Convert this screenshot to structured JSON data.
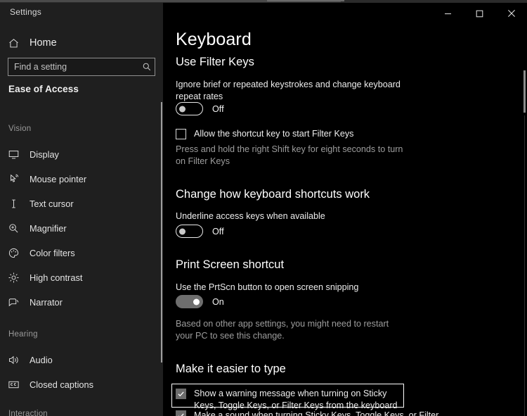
{
  "window": {
    "app_title": "Settings",
    "controls": [
      {
        "name": "minimize",
        "glyph": "–"
      },
      {
        "name": "maximize",
        "glyph": "□"
      },
      {
        "name": "close",
        "glyph": "✕"
      }
    ]
  },
  "sidebar": {
    "home_label": "Home",
    "home_icon": "home-icon",
    "search": {
      "placeholder": "Find a setting",
      "value": "",
      "icon": "search-icon"
    },
    "category_title": "Ease of Access",
    "groups": [
      {
        "heading": "Vision",
        "items": [
          {
            "label": "Display",
            "icon": "monitor-icon"
          },
          {
            "label": "Mouse pointer",
            "icon": "mouse-pointer-icon"
          },
          {
            "label": "Text cursor",
            "icon": "text-cursor-icon"
          },
          {
            "label": "Magnifier",
            "icon": "magnifier-icon"
          },
          {
            "label": "Color filters",
            "icon": "color-palette-icon"
          },
          {
            "label": "High contrast",
            "icon": "sun-contrast-icon"
          },
          {
            "label": "Narrator",
            "icon": "narrator-icon"
          }
        ]
      },
      {
        "heading": "Hearing",
        "items": [
          {
            "label": "Audio",
            "icon": "speaker-icon"
          },
          {
            "label": "Closed captions",
            "icon": "closed-captions-icon"
          }
        ]
      },
      {
        "heading": "Interaction",
        "items": []
      }
    ]
  },
  "main": {
    "page_title": "Keyboard",
    "sections": {
      "filter_keys": {
        "heading": "Use Filter Keys",
        "description": "Ignore brief or repeated keystrokes and change keyboard repeat rates",
        "toggle_state": "Off",
        "checkbox_label": "Allow the shortcut key to start Filter Keys",
        "checkbox_checked": false,
        "hint": "Press and hold the right Shift key for eight seconds to turn on Filter Keys"
      },
      "shortcuts": {
        "heading": "Change how keyboard shortcuts work",
        "description": "Underline access keys when available",
        "toggle_state": "Off"
      },
      "print_screen": {
        "heading": "Print Screen shortcut",
        "description": "Use the PrtScn button to open screen snipping",
        "toggle_state": "On",
        "hint": "Based on other app settings, you might need to restart your PC to see this change."
      },
      "easier_to_type": {
        "heading": "Make it easier to type",
        "checkboxes": [
          {
            "label": "Show a warning message when turning on Sticky Keys, Toggle Keys, or Filter Keys from the keyboard",
            "checked": true,
            "focused": true
          },
          {
            "label": "Make a sound when turning Sticky Keys, Toggle Keys, or Filter",
            "checked": true,
            "focused": false
          }
        ]
      }
    }
  }
}
